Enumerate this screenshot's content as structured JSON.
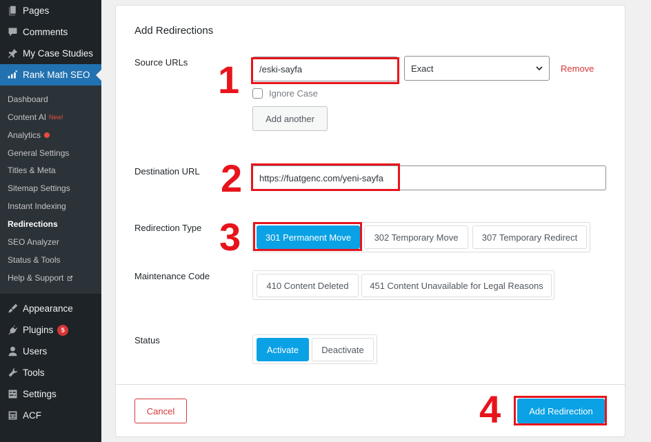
{
  "sidebar": {
    "items_top": [
      {
        "label": "Pages",
        "icon": "pages-icon"
      },
      {
        "label": "Comments",
        "icon": "comments-icon"
      },
      {
        "label": "My Case Studies",
        "icon": "pin-icon"
      },
      {
        "label": "Rank Math SEO",
        "icon": "rank-math-icon"
      }
    ],
    "submenu": [
      {
        "label": "Dashboard"
      },
      {
        "label": "Content AI",
        "badge": "New!"
      },
      {
        "label": "Analytics"
      },
      {
        "label": "General Settings"
      },
      {
        "label": "Titles & Meta"
      },
      {
        "label": "Sitemap Settings"
      },
      {
        "label": "Instant Indexing"
      },
      {
        "label": "Redirections"
      },
      {
        "label": "SEO Analyzer"
      },
      {
        "label": "Status & Tools"
      },
      {
        "label": "Help & Support"
      }
    ],
    "items_bottom": [
      {
        "label": "Appearance",
        "icon": "brush-icon"
      },
      {
        "label": "Plugins",
        "icon": "plugin-icon",
        "count": "5"
      },
      {
        "label": "Users",
        "icon": "user-icon"
      },
      {
        "label": "Tools",
        "icon": "wrench-icon"
      },
      {
        "label": "Settings",
        "icon": "settings-icon"
      },
      {
        "label": "ACF",
        "icon": "acf-icon"
      }
    ]
  },
  "form": {
    "title": "Add Redirections",
    "source": {
      "label": "Source URLs",
      "value": "/eski-sayfa",
      "match_type": "Exact",
      "remove_label": "Remove",
      "ignore_case_label": "Ignore Case",
      "add_another_label": "Add another"
    },
    "destination": {
      "label": "Destination URL",
      "value": "https://fuatgenc.com/yeni-sayfa"
    },
    "redirection_type": {
      "label": "Redirection Type",
      "options": [
        "301 Permanent Move",
        "302 Temporary Move",
        "307 Temporary Redirect"
      ],
      "selected": "301 Permanent Move"
    },
    "maintenance_code": {
      "label": "Maintenance Code",
      "options": [
        "410 Content Deleted",
        "451 Content Unavailable for Legal Reasons"
      ]
    },
    "status": {
      "label": "Status",
      "options": [
        "Activate",
        "Deactivate"
      ],
      "selected": "Activate"
    },
    "cancel_label": "Cancel",
    "submit_label": "Add Redirection"
  },
  "annotations": {
    "step1": "1",
    "step2": "2",
    "step3": "3",
    "step4": "4",
    "highlight_color": "#e8141b"
  },
  "colors": {
    "sidebar_bg": "#1d2327",
    "submenu_bg": "#2c3338",
    "active_menu": "#2271b1",
    "accent_blue": "#0aa1e5",
    "danger": "#d63638"
  }
}
